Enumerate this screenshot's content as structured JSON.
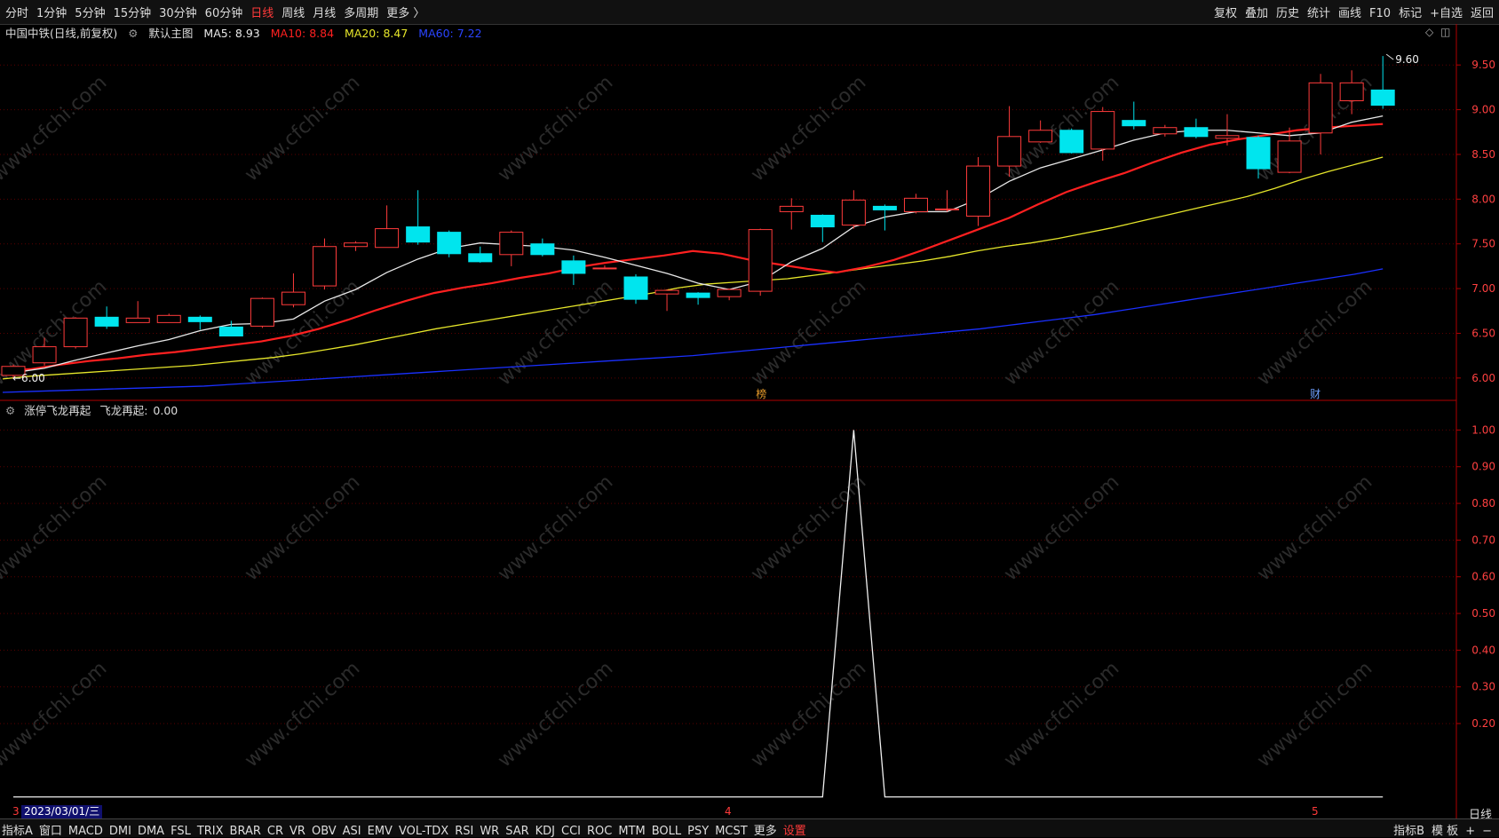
{
  "toolbar": {
    "left_items": [
      "分时",
      "1分钟",
      "5分钟",
      "15分钟",
      "30分钟",
      "60分钟",
      "日线",
      "周线",
      "月线",
      "多周期",
      "更多 〉"
    ],
    "active_index": 6,
    "right_items": [
      "复权",
      "叠加",
      "历史",
      "统计",
      "画线",
      "F10",
      "标记",
      "+自选",
      "返回"
    ]
  },
  "main_info": {
    "name": "中国中铁(日线,前复权)",
    "indicator": "默认主图",
    "ma5_label": "MA5:",
    "ma5": "8.93",
    "ma10_label": "MA10:",
    "ma10": "8.84",
    "ma20_label": "MA20:",
    "ma20": "8.47",
    "ma60_label": "MA60:",
    "ma60": "7.22"
  },
  "sub_info": {
    "name": "涨停飞龙再起",
    "series_label": "飞龙再起:",
    "value": "0.00"
  },
  "colors": {
    "up": "#ff3b3b",
    "down": "#00e5ee",
    "ma5": "#e8e8e8",
    "ma10": "#ff2020",
    "ma20": "#e6e62a",
    "ma60": "#1a30ff",
    "grid": "#5a0000",
    "axis": "#b00000"
  },
  "markers": {
    "left_price": "6.00",
    "right_price": "9.60",
    "event1": "榜",
    "event2": "财"
  },
  "date": {
    "label": "2023/03/01/三",
    "month_ticks": [
      "3",
      "4",
      "5"
    ]
  },
  "bottom": {
    "tabs": [
      "指标A",
      "窗口",
      "MACD",
      "DMI",
      "DMA",
      "FSL",
      "TRIX",
      "BRAR",
      "CR",
      "VR",
      "OBV",
      "ASI",
      "EMV",
      "VOL-TDX",
      "RSI",
      "WR",
      "SAR",
      "KDJ",
      "CCI",
      "ROC",
      "MTM",
      "BOLL",
      "PSY",
      "MCST",
      "更多",
      "设置"
    ],
    "right_tabs": [
      "指标B",
      "模 板",
      "+",
      "−"
    ],
    "period": "日线"
  },
  "chart_data": [
    {
      "type": "candlestick",
      "title": "中国中铁(日线,前复权)",
      "y_axis_ticks": [
        "9.50",
        "9.00",
        "8.50",
        "8.00",
        "7.50",
        "7.00",
        "6.50",
        "6.00"
      ],
      "ylim": [
        5.8,
        9.75
      ],
      "candles": [
        {
          "o": 6.03,
          "h": 6.15,
          "l": 5.99,
          "c": 6.13
        },
        {
          "o": 6.17,
          "h": 6.45,
          "l": 6.14,
          "c": 6.35
        },
        {
          "o": 6.35,
          "h": 6.68,
          "l": 6.33,
          "c": 6.67
        },
        {
          "o": 6.68,
          "h": 6.8,
          "l": 6.55,
          "c": 6.58
        },
        {
          "o": 6.62,
          "h": 6.86,
          "l": 6.62,
          "c": 6.67
        },
        {
          "o": 6.62,
          "h": 6.72,
          "l": 6.62,
          "c": 6.7
        },
        {
          "o": 6.68,
          "h": 6.7,
          "l": 6.54,
          "c": 6.63
        },
        {
          "o": 6.57,
          "h": 6.64,
          "l": 6.47,
          "c": 6.47
        },
        {
          "o": 6.58,
          "h": 6.9,
          "l": 6.56,
          "c": 6.89
        },
        {
          "o": 6.82,
          "h": 7.17,
          "l": 6.79,
          "c": 6.96
        },
        {
          "o": 7.03,
          "h": 7.56,
          "l": 6.99,
          "c": 7.47
        },
        {
          "o": 7.47,
          "h": 7.53,
          "l": 7.42,
          "c": 7.51
        },
        {
          "o": 7.46,
          "h": 7.93,
          "l": 7.46,
          "c": 7.67
        },
        {
          "o": 7.69,
          "h": 8.1,
          "l": 7.49,
          "c": 7.52
        },
        {
          "o": 7.63,
          "h": 7.65,
          "l": 7.35,
          "c": 7.39
        },
        {
          "o": 7.39,
          "h": 7.47,
          "l": 7.29,
          "c": 7.3
        },
        {
          "o": 7.38,
          "h": 7.65,
          "l": 7.25,
          "c": 7.63
        },
        {
          "o": 7.5,
          "h": 7.56,
          "l": 7.36,
          "c": 7.38
        },
        {
          "o": 7.31,
          "h": 7.37,
          "l": 7.04,
          "c": 7.17
        },
        {
          "o": 7.23,
          "h": 7.26,
          "l": 7.23,
          "c": 7.23
        },
        {
          "o": 7.13,
          "h": 7.16,
          "l": 6.83,
          "c": 6.88
        },
        {
          "o": 6.94,
          "h": 6.99,
          "l": 6.75,
          "c": 6.98
        },
        {
          "o": 6.95,
          "h": 6.96,
          "l": 6.82,
          "c": 6.9
        },
        {
          "o": 6.91,
          "h": 7.0,
          "l": 6.87,
          "c": 6.99
        },
        {
          "o": 6.97,
          "h": 7.67,
          "l": 6.92,
          "c": 7.66
        },
        {
          "o": 7.86,
          "h": 8.01,
          "l": 7.66,
          "c": 7.92
        },
        {
          "o": 7.82,
          "h": 7.83,
          "l": 7.52,
          "c": 7.69
        },
        {
          "o": 7.71,
          "h": 8.1,
          "l": 7.67,
          "c": 7.99
        },
        {
          "o": 7.92,
          "h": 7.94,
          "l": 7.65,
          "c": 7.88
        },
        {
          "o": 7.86,
          "h": 8.06,
          "l": 7.84,
          "c": 8.01
        },
        {
          "o": 7.89,
          "h": 8.1,
          "l": 7.86,
          "c": 7.89
        },
        {
          "o": 7.81,
          "h": 8.47,
          "l": 7.7,
          "c": 8.37
        },
        {
          "o": 8.37,
          "h": 9.04,
          "l": 8.25,
          "c": 8.7
        },
        {
          "o": 8.64,
          "h": 8.88,
          "l": 8.63,
          "c": 8.77
        },
        {
          "o": 8.77,
          "h": 8.79,
          "l": 8.51,
          "c": 8.52
        },
        {
          "o": 8.56,
          "h": 9.03,
          "l": 8.43,
          "c": 8.98
        },
        {
          "o": 8.88,
          "h": 9.09,
          "l": 8.78,
          "c": 8.82
        },
        {
          "o": 8.73,
          "h": 8.83,
          "l": 8.7,
          "c": 8.8
        },
        {
          "o": 8.8,
          "h": 8.9,
          "l": 8.68,
          "c": 8.7
        },
        {
          "o": 8.68,
          "h": 8.95,
          "l": 8.6,
          "c": 8.71
        },
        {
          "o": 8.69,
          "h": 8.71,
          "l": 8.23,
          "c": 8.34
        },
        {
          "o": 8.3,
          "h": 8.8,
          "l": 8.29,
          "c": 8.65
        },
        {
          "o": 8.74,
          "h": 9.4,
          "l": 8.5,
          "c": 9.3
        },
        {
          "o": 9.1,
          "h": 9.44,
          "l": 8.95,
          "c": 9.3
        },
        {
          "o": 9.22,
          "h": 9.6,
          "l": 9.01,
          "c": 9.05
        }
      ],
      "ma5": [
        6.06,
        6.11,
        6.2,
        6.28,
        6.36,
        6.43,
        6.53,
        6.6,
        6.61,
        6.66,
        6.86,
        6.99,
        7.18,
        7.33,
        7.45,
        7.51,
        7.49,
        7.47,
        7.43,
        7.35,
        7.26,
        7.17,
        7.06,
        6.99,
        7.08,
        7.3,
        7.45,
        7.69,
        7.8,
        7.86,
        7.86,
        8.0,
        8.2,
        8.35,
        8.45,
        8.55,
        8.66,
        8.74,
        8.77,
        8.77,
        8.74,
        8.71,
        8.74,
        8.86,
        8.93
      ],
      "ma10": [
        6.08,
        6.1,
        6.15,
        6.19,
        6.22,
        6.26,
        6.29,
        6.33,
        6.37,
        6.41,
        6.47,
        6.55,
        6.65,
        6.76,
        6.86,
        6.95,
        7.01,
        7.06,
        7.12,
        7.17,
        7.24,
        7.29,
        7.33,
        7.37,
        7.42,
        7.39,
        7.32,
        7.27,
        7.22,
        7.18,
        7.24,
        7.32,
        7.43,
        7.55,
        7.67,
        7.79,
        7.94,
        8.08,
        8.19,
        8.29,
        8.41,
        8.52,
        8.61,
        8.67,
        8.72,
        8.77,
        8.8,
        8.82,
        8.84
      ],
      "ma20": [
        5.99,
        6.02,
        6.04,
        6.06,
        6.08,
        6.1,
        6.12,
        6.14,
        6.17,
        6.2,
        6.23,
        6.27,
        6.32,
        6.37,
        6.43,
        6.49,
        6.55,
        6.6,
        6.65,
        6.7,
        6.75,
        6.8,
        6.85,
        6.9,
        6.95,
        7.01,
        7.05,
        7.07,
        7.09,
        7.11,
        7.15,
        7.19,
        7.23,
        7.27,
        7.31,
        7.36,
        7.42,
        7.47,
        7.51,
        7.56,
        7.62,
        7.68,
        7.75,
        7.82,
        7.89,
        7.96,
        8.03,
        8.12,
        8.22,
        8.31,
        8.39,
        8.47
      ],
      "ma60": [
        5.84,
        5.85,
        5.86,
        5.87,
        5.88,
        5.89,
        5.9,
        5.91,
        5.93,
        5.95,
        5.97,
        5.99,
        6.01,
        6.03,
        6.05,
        6.07,
        6.09,
        6.11,
        6.13,
        6.15,
        6.17,
        6.19,
        6.21,
        6.23,
        6.25,
        6.28,
        6.31,
        6.34,
        6.37,
        6.4,
        6.43,
        6.46,
        6.49,
        6.52,
        6.55,
        6.59,
        6.63,
        6.67,
        6.71,
        6.76,
        6.81,
        6.86,
        6.91,
        6.96,
        7.01,
        7.06,
        7.11,
        7.16,
        7.22
      ]
    },
    {
      "type": "line",
      "title": "涨停飞龙再起",
      "y_axis_ticks": [
        "1.00",
        "0.90",
        "0.80",
        "0.70",
        "0.60",
        "0.50",
        "0.40",
        "0.30",
        "0.20"
      ],
      "ylim": [
        -0.02,
        1.03
      ],
      "series": [
        {
          "name": "飞龙再起",
          "values": [
            0,
            0,
            0,
            0,
            0,
            0,
            0,
            0,
            0,
            0,
            0,
            0,
            0,
            0,
            0,
            0,
            0,
            0,
            0,
            0,
            0,
            0,
            0,
            0,
            0,
            0,
            0,
            1,
            0,
            0,
            0,
            0,
            0,
            0,
            0,
            0,
            0,
            0,
            0,
            0,
            0,
            0,
            0,
            0,
            0
          ]
        }
      ]
    }
  ]
}
